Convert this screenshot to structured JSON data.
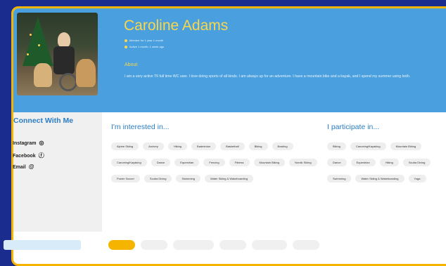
{
  "profile": {
    "name": "Caroline Adams",
    "meta": [
      "Member for 1 year 1 month",
      "Active 1 month, 1 week ago"
    ],
    "about_heading": "About",
    "about_text": "I am a very active T6 full time WC user. I love doing sports of all kinds. I am always up for an adventure. I have a mountain bike and a kayak, and I spend my summer using both."
  },
  "sidebar": {
    "heading": "Connect With Me",
    "links": [
      {
        "label": "Instagram",
        "icon": "instagram-icon",
        "glyph": "◎"
      },
      {
        "label": "Facebook",
        "icon": "facebook-icon",
        "glyph": "ⓕ"
      },
      {
        "label": "Email",
        "icon": "email-icon",
        "glyph": "@"
      }
    ]
  },
  "interested": {
    "heading": "I'm interested in...",
    "items": [
      "Alpine Skiing",
      "Archery",
      "Hiking",
      "Badminton",
      "Basketball",
      "Biking",
      "Bowling",
      "Canoeing/Kayaking",
      "Dance",
      "Equestrian",
      "Fencing",
      "Fitness",
      "Mountain Biking",
      "Nordic Skiing",
      "Power Soccer",
      "Scuba Diving",
      "Swimming",
      "Water Skiing & Wakeboarding"
    ]
  },
  "participate": {
    "heading": "I participate in...",
    "items": [
      "Biking",
      "Canoeing/Kayaking",
      "Mountain Biking",
      "Dance",
      "Equestrian",
      "Hiking",
      "Scuba Diving",
      "Swimming",
      "Water Skiing & Wakeboarding",
      "Yoga"
    ]
  },
  "colors": {
    "accent": "#f4b400",
    "hero": "#4aa0de",
    "heading": "#2a7dc3",
    "background": "#1a2d8f"
  }
}
